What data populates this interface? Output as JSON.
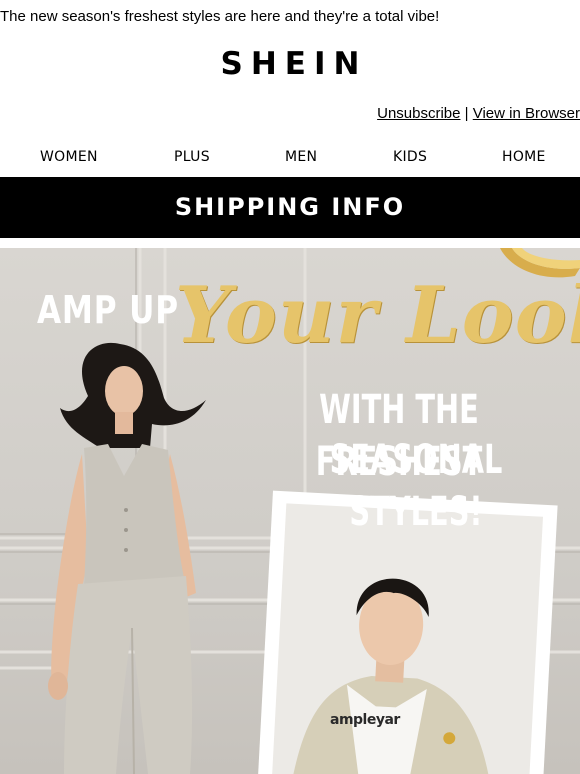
{
  "preheader": "The new season's freshest styles are here and they're a total vibe!",
  "brand": "SHEIN",
  "links": {
    "unsubscribe": "Unsubscribe",
    "separator": "|",
    "view_in_browser": "View in Browser"
  },
  "nav": [
    "WOMEN",
    "PLUS",
    "MEN",
    "KIDS",
    "HOME"
  ],
  "shipping_bar": "SHIPPING INFO",
  "hero": {
    "line1": "AMP UP",
    "line2": "Your Look",
    "line3a": "WITH THE FRESHEST",
    "line3b": "SEASONAL STYLES!",
    "shirt_print": "ampleyar",
    "colors": {
      "gold": "#e6c46a",
      "background": "#d3d0cb"
    }
  }
}
